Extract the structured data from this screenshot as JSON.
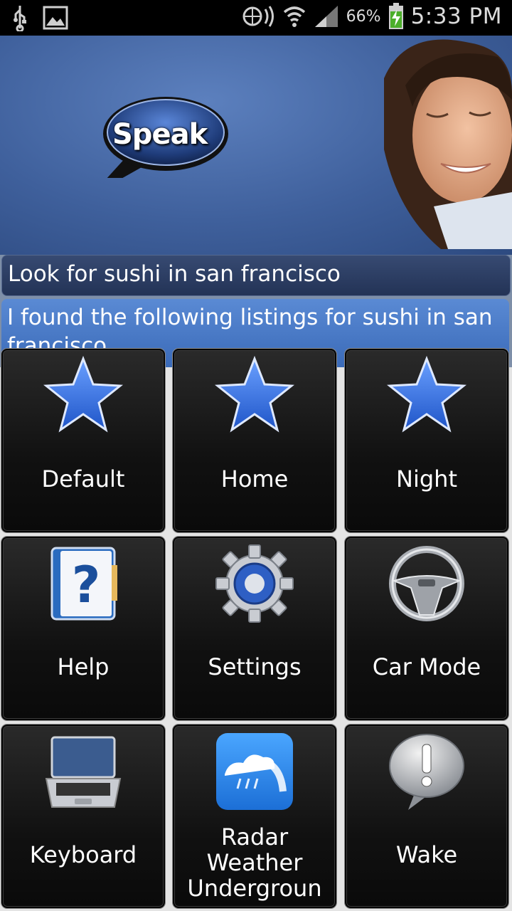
{
  "status_bar": {
    "battery_percent": "66%",
    "time": "5:33 PM",
    "icons": [
      "usb-icon",
      "gallery-icon",
      "nfc-icon",
      "wifi-icon",
      "signal-icon",
      "battery-charging-icon"
    ]
  },
  "header": {
    "speak_label": "Speak"
  },
  "conversation": {
    "query": "Look for sushi in san francisco",
    "answer": "I found the following listings for sushi in san francisco"
  },
  "menu": {
    "items": [
      {
        "label": "Default",
        "icon": "star-icon"
      },
      {
        "label": "Home",
        "icon": "star-icon"
      },
      {
        "label": "Night",
        "icon": "star-icon"
      },
      {
        "label": "Help",
        "icon": "help-book-icon"
      },
      {
        "label": "Settings",
        "icon": "gear-icon"
      },
      {
        "label": "Car Mode",
        "icon": "steering-wheel-icon"
      },
      {
        "label": "Keyboard",
        "icon": "laptop-icon"
      },
      {
        "label": "Radar Weather Undergroun",
        "label_lines": [
          "Radar",
          "Weather",
          "Undergroun"
        ],
        "icon": "weather-radar-icon"
      },
      {
        "label": "Wake",
        "icon": "alert-bubble-icon"
      }
    ]
  },
  "colors": {
    "header_blue": "#3f609c",
    "tile_black": "#111111",
    "star_blue": "#2f6fe0"
  }
}
